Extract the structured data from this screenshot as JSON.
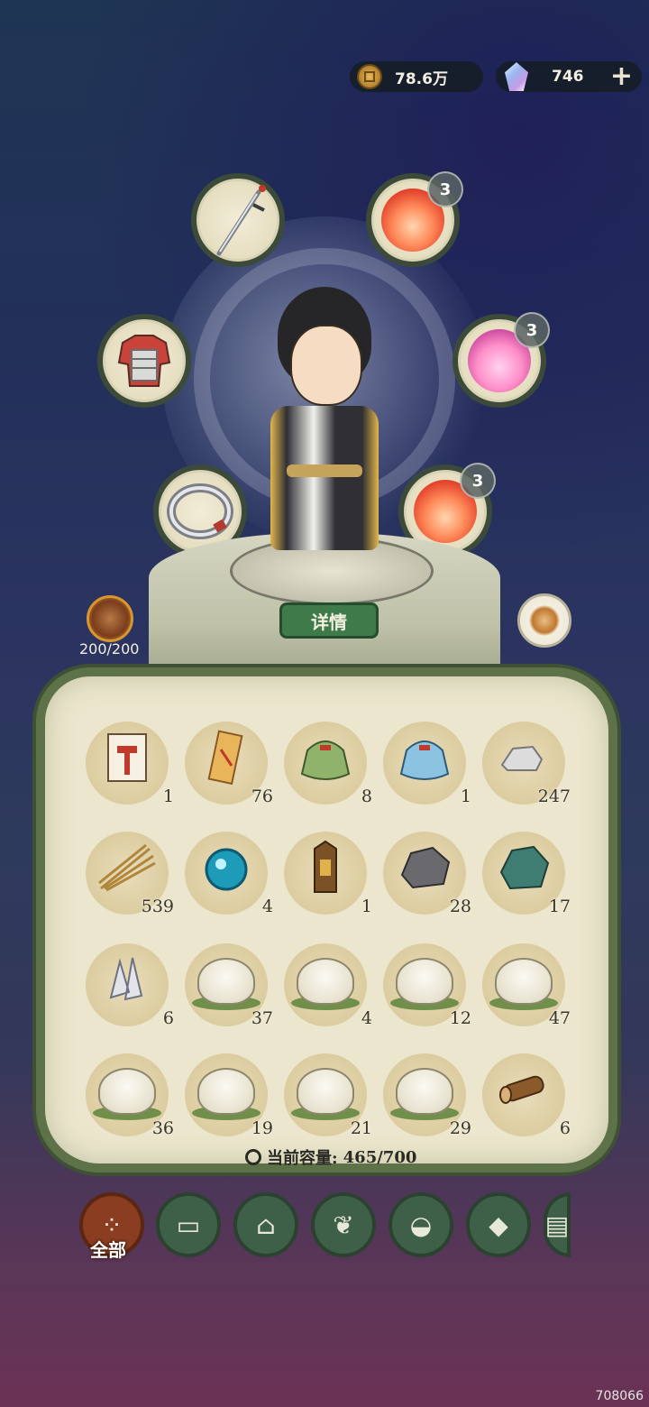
{
  "currency": {
    "coins": "78.6万",
    "gems": "746",
    "add_label": "+"
  },
  "equipment": {
    "slots": [
      {
        "name": "weapon-sword",
        "badge": ""
      },
      {
        "name": "armor",
        "badge": ""
      },
      {
        "name": "ring",
        "badge": ""
      },
      {
        "name": "companion-fire-spirit",
        "badge": "3"
      },
      {
        "name": "companion-jackal-mask",
        "badge": "3"
      },
      {
        "name": "companion-warrior-face",
        "badge": "3"
      }
    ]
  },
  "character": {
    "details_label": "详情",
    "stamina": "200/200"
  },
  "inventory": {
    "items": [
      {
        "icon": "recipe-card-icon",
        "qty": "1"
      },
      {
        "icon": "scroll-icon",
        "qty": "76"
      },
      {
        "icon": "green-seed-bag-icon",
        "qty": "8"
      },
      {
        "icon": "blue-seed-bag-icon",
        "qty": "1"
      },
      {
        "icon": "stone-icon",
        "qty": "247"
      },
      {
        "icon": "hay-icon",
        "qty": "539"
      },
      {
        "icon": "blue-orb-icon",
        "qty": "4"
      },
      {
        "icon": "token-icon",
        "qty": "1"
      },
      {
        "icon": "iron-ore-icon",
        "qty": "28"
      },
      {
        "icon": "jade-ore-icon",
        "qty": "17"
      },
      {
        "icon": "crystal-icon",
        "qty": "6"
      },
      {
        "icon": "chicken-egg-icon",
        "qty": "37"
      },
      {
        "icon": "duck-egg-icon",
        "qty": "4"
      },
      {
        "icon": "goose-egg-icon",
        "qty": "12"
      },
      {
        "icon": "mallard-egg-icon",
        "qty": "47"
      },
      {
        "icon": "ox-calf-icon",
        "qty": "36"
      },
      {
        "icon": "sheep-lamb-icon",
        "qty": "19"
      },
      {
        "icon": "horse-foal-icon",
        "qty": "21"
      },
      {
        "icon": "piglet-icon",
        "qty": "29"
      },
      {
        "icon": "log-icon",
        "qty": "6"
      }
    ],
    "capacity_label": "当前容量:",
    "capacity_value": "465/700"
  },
  "tabs": [
    {
      "icon": "all-icon",
      "label": "全部",
      "active": true
    },
    {
      "icon": "wood-icon"
    },
    {
      "icon": "building-icon"
    },
    {
      "icon": "herb-icon"
    },
    {
      "icon": "food-bowl-icon"
    },
    {
      "icon": "ore-icon"
    },
    {
      "icon": "scroll-tab-icon"
    }
  ],
  "watermark": "708066",
  "colors": {
    "panel_border": "#5d7249",
    "active_tab": "#8a3d20",
    "tab": "#3f6048",
    "details_button": "#3f7a4a"
  }
}
